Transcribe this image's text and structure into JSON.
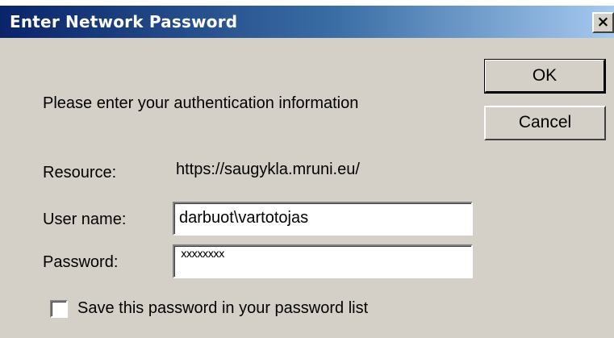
{
  "window": {
    "title": "Enter Network Password",
    "close_glyph": "×"
  },
  "buttons": {
    "ok_label": "OK",
    "cancel_label": "Cancel"
  },
  "prompt": "Please enter your authentication information",
  "resource": {
    "label": "Resource:",
    "value": "https://saugykla.mruni.eu/"
  },
  "username": {
    "label": "User name:",
    "value": "darbuot\\vartotojas"
  },
  "password": {
    "label": "Password:",
    "value": "xxxxxxxx"
  },
  "save_password": {
    "label": "Save this password in your password list",
    "checked": false
  },
  "colors": {
    "title_bar_start": "#0a246a",
    "title_bar_end": "#a6caf0",
    "dialog_background": "#d4d0c8"
  }
}
